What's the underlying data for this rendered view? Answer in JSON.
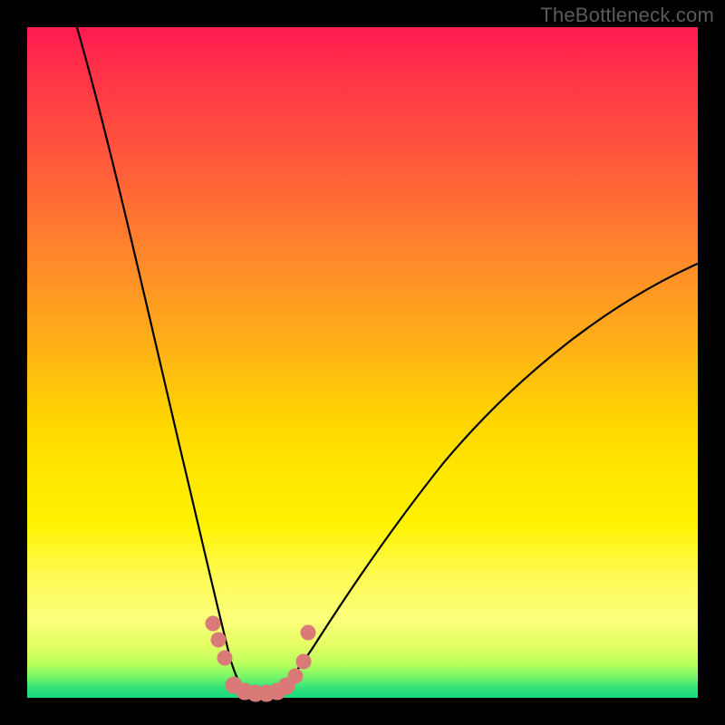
{
  "watermark": "TheBottleneck.com",
  "chart_data": {
    "type": "line",
    "title": "",
    "xlabel": "",
    "ylabel": "",
    "xlim": [
      0,
      100
    ],
    "ylim": [
      0,
      100
    ],
    "grid": false,
    "legend": false,
    "series": [
      {
        "name": "left-curve",
        "x": [
          7,
          10,
          14,
          18,
          22,
          25,
          27,
          28.5,
          30,
          31,
          32
        ],
        "values": [
          100,
          86,
          68,
          48,
          28,
          14,
          7,
          3.5,
          1.5,
          0.7,
          0.4
        ]
      },
      {
        "name": "right-curve",
        "x": [
          35,
          36,
          38,
          41,
          45,
          50,
          56,
          63,
          72,
          82,
          92,
          100
        ],
        "values": [
          0.4,
          0.8,
          2,
          4.2,
          8.5,
          14,
          21,
          29,
          38,
          48,
          57,
          64
        ]
      },
      {
        "name": "markers",
        "style": "points",
        "color": "#d97a78",
        "x": [
          26,
          27,
          28,
          30,
          31,
          33,
          35,
          36,
          37,
          38,
          39,
          40
        ],
        "values": [
          11,
          9,
          6,
          1,
          0.7,
          0.5,
          0.5,
          0.7,
          1.2,
          2.4,
          5,
          10
        ]
      }
    ],
    "background_gradient": {
      "top": "#ff1a4f",
      "mid1": "#ffb216",
      "mid2": "#fff200",
      "bottom": "#18d87f"
    }
  }
}
